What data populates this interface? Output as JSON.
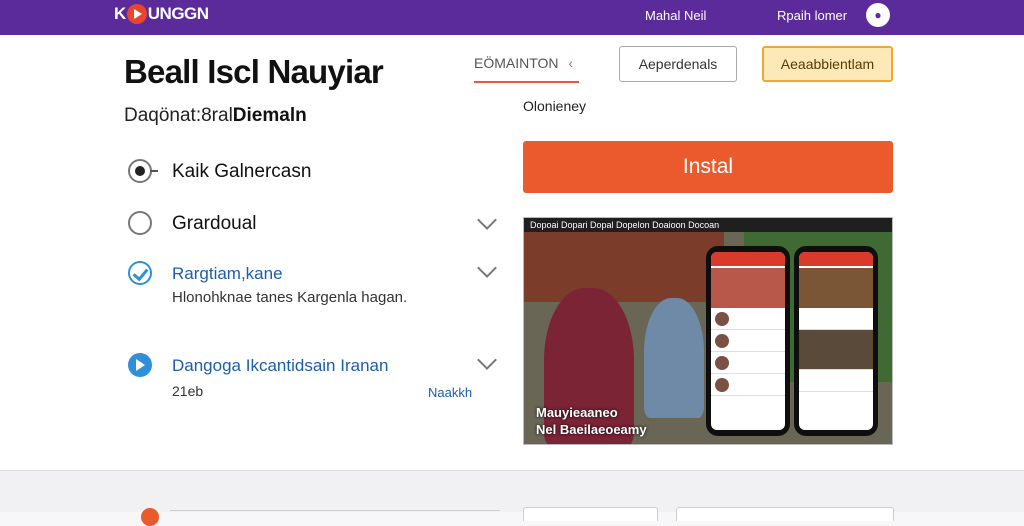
{
  "topbar": {
    "logo_prefix": "K",
    "logo_suffix": "UNGGN",
    "menu_label": "Mahal Neil",
    "account_label": "Rpaih lomer",
    "avatar_icon": "user-icon"
  },
  "header": {
    "title": "Beall Iscl Nauyiar",
    "subtitle_prefix": "Daqönat:8ral",
    "subtitle_bold": "Diemaln",
    "edition_tab": "EÖMAINTON",
    "edition_tab_icon": "chevron-icon",
    "outline_button": "Aeperdenals",
    "amber_button": "Aeaabbientlam"
  },
  "sidebar_info": {
    "category": "Olonieney",
    "install_label": "Instal"
  },
  "options": [
    {
      "label": "Kaik Galnercasn",
      "icon": "radio-selected-icon"
    },
    {
      "label": "Grardoual",
      "icon": "radio-empty-icon"
    },
    {
      "label": "Rargtiam,kane",
      "desc": "Hlonohknae tanes Kargenla hagan.",
      "icon": "check-circle-icon"
    },
    {
      "label": "Dangoga Ikcantidsain Iranan",
      "small": "21eb",
      "more": "Naakkh",
      "icon": "play-circle-icon"
    }
  ],
  "preview": {
    "bar_text": "Dopoai  Dopari  Dopal  Dopelon  Doaioon  Docoan",
    "caption_line1": "Mauyieaaneo",
    "caption_line2": "Nel Baeilaeoeamy"
  },
  "colors": {
    "brand_purple": "#5b2a9b",
    "accent_orange": "#ea5a2c",
    "amber": "#f0a830",
    "link_blue": "#1e5ea8"
  }
}
